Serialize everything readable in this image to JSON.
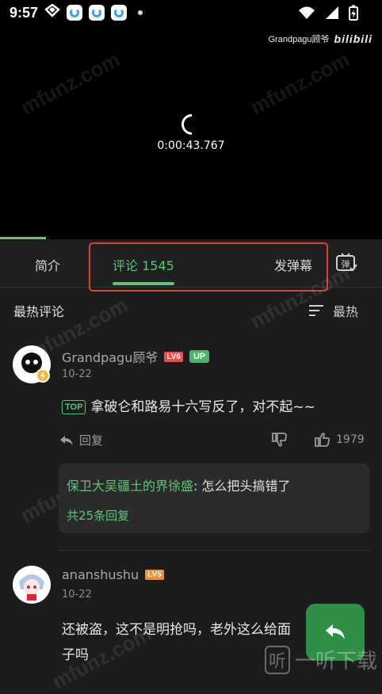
{
  "status_bar": {
    "time": "9:57"
  },
  "video": {
    "uploader_watermark": "Grandpagu顾爷",
    "logo_text": "bilibili",
    "timecode": "0:00:43.767",
    "progress_fraction": 0.12,
    "overlay_watermark": "mfunz.com"
  },
  "tabs": {
    "intro": "简介",
    "comments": "评论 1545",
    "danmaku": "发弹幕",
    "danmaku_icon_label": "弹"
  },
  "sort": {
    "section_title": "最热评论",
    "current": "最热"
  },
  "comments": [
    {
      "username": "Grandpagu顾爷",
      "level": "LV6",
      "badge": "UP",
      "date": "10-22",
      "pinned_tag": "TOP",
      "text": "拿破仑和路易十六写反了，对不起~~",
      "reply_label": "回复",
      "likes": "1979",
      "sub_reply": {
        "author": "保卫大吴疆土的界徐盛",
        "text": ": 怎么把头搞错了",
        "more": "共25条回复"
      }
    },
    {
      "username": "ananshushu",
      "level": "LV5",
      "date": "10-22",
      "text": "还被盗，这不是明抢吗，老外这么给面子吗"
    }
  ],
  "footer_watermark": {
    "icon": "听",
    "text": "一听下载"
  },
  "colors": {
    "accent": "#5fc478",
    "highlight": "#d8442f",
    "lv6": "#f04c49",
    "lv5": "#f08f3a"
  }
}
